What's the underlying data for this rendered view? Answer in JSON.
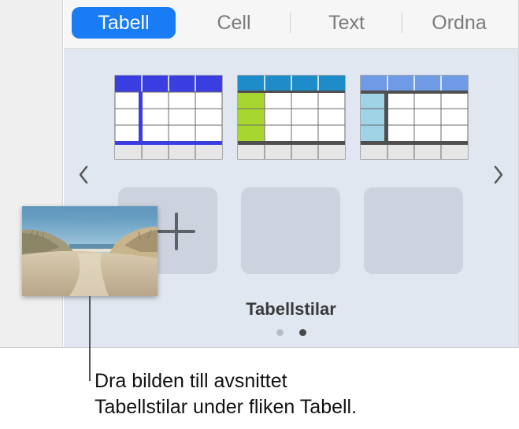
{
  "tabs": [
    {
      "label": "Tabell",
      "active": true
    },
    {
      "label": "Cell",
      "active": false
    },
    {
      "label": "Text",
      "active": false
    },
    {
      "label": "Ordna",
      "active": false
    }
  ],
  "panel": {
    "title": "Tabellstilar",
    "prev_icon": "chevron-left-icon",
    "next_icon": "chevron-right-icon",
    "add_icon": "plus-icon",
    "page_count": 2,
    "current_page": 2
  },
  "table_styles": [
    {
      "name": "table-style-blue",
      "header_color": "#3a3ee0",
      "accent_color": "#3a3ee0"
    },
    {
      "name": "table-style-green",
      "header_color": "#1e8cc8",
      "accent_color": "#a8d630"
    },
    {
      "name": "table-style-light-blue",
      "header_color": "#6f9ae6",
      "accent_color": "#9fd3e6"
    }
  ],
  "callout": {
    "line1": "Dra bilden till avsnittet",
    "line2": "Tabellstilar under fliken Tabell."
  },
  "colors": {
    "accent": "#1a7cf5"
  }
}
